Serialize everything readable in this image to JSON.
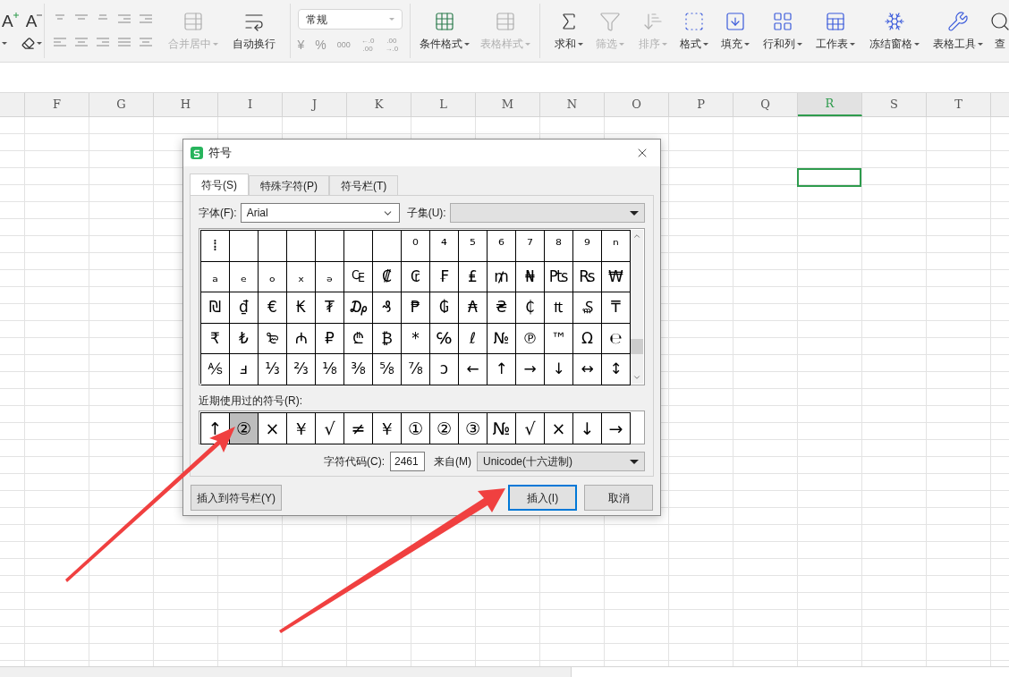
{
  "toolbar": {
    "font_buttons": [
      "A",
      "A"
    ],
    "merge_buttons": [
      {
        "label": "合并居中",
        "disabled": true
      },
      {
        "label": "自动换行",
        "disabled": false
      }
    ],
    "number_format": {
      "value": "常规"
    },
    "number_buttons": [
      "¥",
      "%",
      "000"
    ],
    "decimal_buttons": [
      {
        "top": "←.0",
        "bottom": ".00"
      },
      {
        "top": ".00",
        "bottom": "→.0"
      }
    ],
    "style_buttons": [
      {
        "label": "条件格式",
        "disabled": false
      },
      {
        "label": "表格样式",
        "disabled": true
      }
    ],
    "tool_buttons": [
      {
        "label": "求和",
        "disabled": false
      },
      {
        "label": "筛选",
        "disabled": true
      },
      {
        "label": "排序",
        "disabled": true
      },
      {
        "label": "格式",
        "disabled": false
      },
      {
        "label": "填充",
        "disabled": false
      },
      {
        "label": "行和列",
        "disabled": false
      },
      {
        "label": "工作表",
        "disabled": false
      },
      {
        "label": "冻结窗格",
        "disabled": false
      },
      {
        "label": "表格工具",
        "disabled": false
      },
      {
        "label": "查",
        "disabled": false
      }
    ]
  },
  "sheet": {
    "columns": [
      {
        "label": "F",
        "selected": false
      },
      {
        "label": "G",
        "selected": false
      },
      {
        "label": "H",
        "selected": false
      },
      {
        "label": "I",
        "selected": false
      },
      {
        "label": "J",
        "selected": false
      },
      {
        "label": "K",
        "selected": false
      },
      {
        "label": "L",
        "selected": false
      },
      {
        "label": "M",
        "selected": false
      },
      {
        "label": "N",
        "selected": false
      },
      {
        "label": "O",
        "selected": false
      },
      {
        "label": "P",
        "selected": false
      },
      {
        "label": "Q",
        "selected": false
      },
      {
        "label": "R",
        "selected": true
      },
      {
        "label": "S",
        "selected": false
      },
      {
        "label": "T",
        "selected": false
      }
    ]
  },
  "dialog": {
    "title": "符号",
    "tabs": [
      {
        "label": "符号(S)",
        "selected": true
      },
      {
        "label": "特殊字符(P)",
        "selected": false
      },
      {
        "label": "符号栏(T)",
        "selected": false
      }
    ],
    "font_label": "字体(F):",
    "font_value": "Arial",
    "subset_label": "子集(U):",
    "grid": [
      [
        {
          "kind": "glyph",
          "symbol": "⁞",
          "selected": false
        },
        {
          "kind": "blank",
          "selected": false
        },
        {
          "kind": "blank",
          "selected": false
        },
        {
          "kind": "blank",
          "selected": false
        },
        {
          "kind": "blank",
          "selected": false
        },
        {
          "kind": "blank",
          "selected": false
        },
        {
          "kind": "blank",
          "selected": false
        },
        {
          "kind": "glyph",
          "symbol": "⁰",
          "selected": false
        },
        {
          "kind": "glyph",
          "symbol": "⁴",
          "selected": false
        },
        {
          "kind": "glyph",
          "symbol": "⁵",
          "selected": false
        },
        {
          "kind": "glyph",
          "symbol": "⁶",
          "selected": false
        },
        {
          "kind": "glyph",
          "symbol": "⁷",
          "selected": false
        },
        {
          "kind": "glyph",
          "symbol": "⁸",
          "selected": false
        },
        {
          "kind": "glyph",
          "symbol": "⁹",
          "selected": false
        },
        {
          "kind": "glyph",
          "symbol": "ⁿ",
          "selected": false
        }
      ],
      [
        {
          "kind": "glyph",
          "symbol": "ₐ",
          "selected": false
        },
        {
          "kind": "glyph",
          "symbol": "ₑ",
          "selected": false
        },
        {
          "kind": "glyph",
          "symbol": "ₒ",
          "selected": false
        },
        {
          "kind": "glyph",
          "symbol": "ₓ",
          "selected": false
        },
        {
          "kind": "glyph",
          "symbol": "ₔ",
          "selected": false
        },
        {
          "kind": "glyph",
          "symbol": "₠",
          "selected": false
        },
        {
          "kind": "glyph",
          "symbol": "₡",
          "selected": false
        },
        {
          "kind": "glyph",
          "symbol": "₢",
          "selected": false
        },
        {
          "kind": "glyph",
          "symbol": "₣",
          "selected": false
        },
        {
          "kind": "glyph",
          "symbol": "₤",
          "selected": false
        },
        {
          "kind": "glyph",
          "symbol": "₥",
          "selected": false
        },
        {
          "kind": "glyph",
          "symbol": "₦",
          "selected": false
        },
        {
          "kind": "glyph",
          "symbol": "₧",
          "selected": false
        },
        {
          "kind": "glyph",
          "symbol": "₨",
          "selected": false
        },
        {
          "kind": "glyph",
          "symbol": "₩",
          "selected": false
        }
      ],
      [
        {
          "kind": "glyph",
          "symbol": "₪",
          "selected": false
        },
        {
          "kind": "glyph",
          "symbol": "₫",
          "selected": false
        },
        {
          "kind": "glyph",
          "symbol": "€",
          "selected": false
        },
        {
          "kind": "glyph",
          "symbol": "₭",
          "selected": false
        },
        {
          "kind": "glyph",
          "symbol": "₮",
          "selected": false
        },
        {
          "kind": "glyph",
          "symbol": "₯",
          "selected": false
        },
        {
          "kind": "glyph",
          "symbol": "₰",
          "selected": false
        },
        {
          "kind": "glyph",
          "symbol": "₱",
          "selected": false
        },
        {
          "kind": "glyph",
          "symbol": "₲",
          "selected": false
        },
        {
          "kind": "glyph",
          "symbol": "₳",
          "selected": false
        },
        {
          "kind": "glyph",
          "symbol": "₴",
          "selected": false
        },
        {
          "kind": "glyph",
          "symbol": "₵",
          "selected": false
        },
        {
          "kind": "glyph",
          "symbol": "₶",
          "selected": false
        },
        {
          "kind": "glyph",
          "symbol": "₷",
          "selected": false
        },
        {
          "kind": "glyph",
          "symbol": "₸",
          "selected": false
        }
      ],
      [
        {
          "kind": "glyph",
          "symbol": "₹",
          "selected": false
        },
        {
          "kind": "glyph",
          "symbol": "₺",
          "selected": false
        },
        {
          "kind": "glyph",
          "symbol": "₻",
          "selected": false
        },
        {
          "kind": "glyph",
          "symbol": "₼",
          "selected": false
        },
        {
          "kind": "glyph",
          "symbol": "₽",
          "selected": false
        },
        {
          "kind": "glyph",
          "symbol": "₾",
          "selected": false
        },
        {
          "kind": "glyph",
          "symbol": "₿",
          "selected": false
        },
        {
          "kind": "glyph",
          "symbol": "*",
          "selected": false
        },
        {
          "kind": "glyph",
          "symbol": "℅",
          "selected": false
        },
        {
          "kind": "glyph",
          "symbol": "ℓ",
          "selected": false
        },
        {
          "kind": "glyph",
          "symbol": "№",
          "selected": false
        },
        {
          "kind": "glyph",
          "symbol": "℗",
          "selected": false
        },
        {
          "kind": "glyph",
          "symbol": "™",
          "selected": false
        },
        {
          "kind": "glyph",
          "symbol": "Ω",
          "selected": false
        },
        {
          "kind": "glyph",
          "symbol": "℮",
          "selected": false
        }
      ],
      [
        {
          "kind": "glyph",
          "symbol": "⅍",
          "selected": false
        },
        {
          "kind": "glyph",
          "symbol": "ⅎ",
          "selected": false
        },
        {
          "kind": "glyph",
          "symbol": "⅓",
          "selected": false
        },
        {
          "kind": "glyph",
          "symbol": "⅔",
          "selected": false
        },
        {
          "kind": "glyph",
          "symbol": "⅛",
          "selected": false
        },
        {
          "kind": "glyph",
          "symbol": "⅜",
          "selected": false
        },
        {
          "kind": "glyph",
          "symbol": "⅝",
          "selected": false
        },
        {
          "kind": "glyph",
          "symbol": "⅞",
          "selected": false
        },
        {
          "kind": "glyph",
          "symbol": "ↄ",
          "selected": false
        },
        {
          "kind": "glyph",
          "symbol": "←",
          "selected": false
        },
        {
          "kind": "glyph",
          "symbol": "↑",
          "selected": false
        },
        {
          "kind": "glyph",
          "symbol": "→",
          "selected": false
        },
        {
          "kind": "glyph",
          "symbol": "↓",
          "selected": false
        },
        {
          "kind": "glyph",
          "symbol": "↔",
          "selected": false
        },
        {
          "kind": "glyph",
          "symbol": "↕",
          "selected": false
        }
      ]
    ],
    "recent_label": "近期使用过的符号(R):",
    "recent": [
      {
        "symbol": "↑",
        "selected": false
      },
      {
        "symbol": "②",
        "selected": true
      },
      {
        "symbol": "×",
        "selected": false
      },
      {
        "symbol": "￥",
        "selected": false
      },
      {
        "symbol": "√",
        "selected": false
      },
      {
        "symbol": "≠",
        "selected": false
      },
      {
        "symbol": "￥",
        "selected": false
      },
      {
        "symbol": "①",
        "selected": false
      },
      {
        "symbol": "②",
        "selected": false
      },
      {
        "symbol": "③",
        "selected": false
      },
      {
        "symbol": "№",
        "selected": false
      },
      {
        "symbol": "√",
        "selected": false
      },
      {
        "symbol": "×",
        "selected": false
      },
      {
        "symbol": "↓",
        "selected": false
      },
      {
        "symbol": "→",
        "selected": false
      }
    ],
    "code_label": "字符代码(C):",
    "code_value": "2461",
    "from_label": "来自(M)",
    "from_value": "Unicode(十六进制)",
    "buttons": [
      {
        "label": "插入到符号栏(Y)",
        "default": false
      },
      {
        "label": "插入(I)",
        "default": true
      },
      {
        "label": "取消",
        "default": false
      }
    ]
  }
}
